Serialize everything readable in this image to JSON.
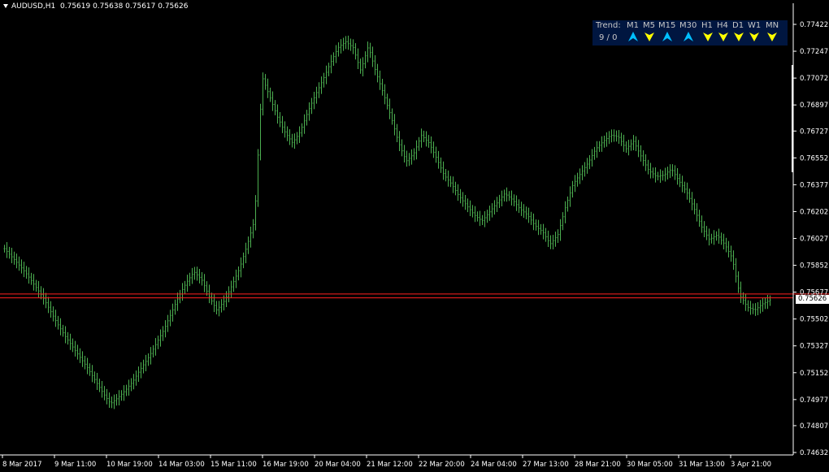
{
  "header": {
    "symbol": "AUDUSD,H1",
    "ohlc": "0.75619 0.75638 0.75617 0.75626"
  },
  "trend_panel": {
    "label": "Trend:",
    "count": "9 / 0",
    "timeframes": [
      {
        "name": "M1",
        "direction": "up",
        "color": "#00bfff"
      },
      {
        "name": "M5",
        "direction": "down",
        "color": "#ffff00"
      },
      {
        "name": "M15",
        "direction": "up",
        "color": "#00bfff"
      },
      {
        "name": "M30",
        "direction": "up",
        "color": "#00bfff"
      },
      {
        "name": "H1",
        "direction": "down",
        "color": "#ffff00"
      },
      {
        "name": "H4",
        "direction": "down",
        "color": "#ffff00"
      },
      {
        "name": "D1",
        "direction": "down",
        "color": "#ffff00"
      },
      {
        "name": "W1",
        "direction": "down",
        "color": "#ffff00"
      },
      {
        "name": "MN",
        "direction": "down",
        "color": "#ffff00"
      }
    ]
  },
  "current_price_label": "0.75626",
  "colors": {
    "background": "#000000",
    "bars": "#4caf50",
    "axis": "#ffffff",
    "bid_line": "#ff2020",
    "ask_line": "#ff2020",
    "trend_panel_bg": "#001640"
  },
  "chart_data": {
    "type": "ohlc",
    "title": "",
    "ylim": [
      0.74632,
      0.77422
    ],
    "y_ticks": [
      "0.77422",
      "0.77247",
      "0.77072",
      "0.76897",
      "0.76727",
      "0.76552",
      "0.76377",
      "0.76202",
      "0.76027",
      "0.75852",
      "0.75677",
      "0.75502",
      "0.75327",
      "0.75152",
      "0.74977",
      "0.74807",
      "0.74632"
    ],
    "x_ticks": [
      "8 Mar 2017",
      "9 Mar 11:00",
      "10 Mar 19:00",
      "14 Mar 03:00",
      "15 Mar 11:00",
      "16 Mar 19:00",
      "20 Mar 04:00",
      "21 Mar 12:00",
      "22 Mar 20:00",
      "24 Mar 04:00",
      "27 Mar 13:00",
      "28 Mar 21:00",
      "30 Mar 05:00",
      "31 Mar 13:00",
      "3 Apr 21:00"
    ],
    "hlines": [
      {
        "name": "ask",
        "value": 0.75665
      },
      {
        "name": "bid",
        "value": 0.7564
      }
    ],
    "series": [
      {
        "name": "AUDUSD,H1",
        "close_path": [
          0.7596,
          0.75905,
          0.7585,
          0.7579,
          0.7572,
          0.7565,
          0.7556,
          0.7547,
          0.7539,
          0.7532,
          0.7525,
          0.7518,
          0.751,
          0.7502,
          0.7495,
          0.7499,
          0.7504,
          0.751,
          0.7518,
          0.7525,
          0.7534,
          0.7543,
          0.7554,
          0.7565,
          0.7574,
          0.7581,
          0.7576,
          0.7565,
          0.7556,
          0.7562,
          0.7572,
          0.7583,
          0.7598,
          0.7615,
          0.7708,
          0.7695,
          0.7682,
          0.7672,
          0.7665,
          0.7672,
          0.7685,
          0.7696,
          0.7706,
          0.7717,
          0.7727,
          0.7731,
          0.7727,
          0.7712,
          0.7728,
          0.7711,
          0.7697,
          0.7682,
          0.7665,
          0.7653,
          0.7658,
          0.767,
          0.7665,
          0.7655,
          0.7644,
          0.7638,
          0.763,
          0.7624,
          0.7618,
          0.7614,
          0.762,
          0.7626,
          0.7632,
          0.7628,
          0.7622,
          0.7618,
          0.7611,
          0.7607,
          0.7599,
          0.7605,
          0.7623,
          0.7638,
          0.7645,
          0.7652,
          0.7661,
          0.7666,
          0.767,
          0.7669,
          0.7661,
          0.7666,
          0.7656,
          0.7647,
          0.7643,
          0.7644,
          0.7648,
          0.764,
          0.7633,
          0.7622,
          0.761,
          0.7602,
          0.7605,
          0.7599,
          0.759,
          0.7566,
          0.7558,
          0.7556,
          0.756,
          0.75626
        ]
      }
    ]
  }
}
